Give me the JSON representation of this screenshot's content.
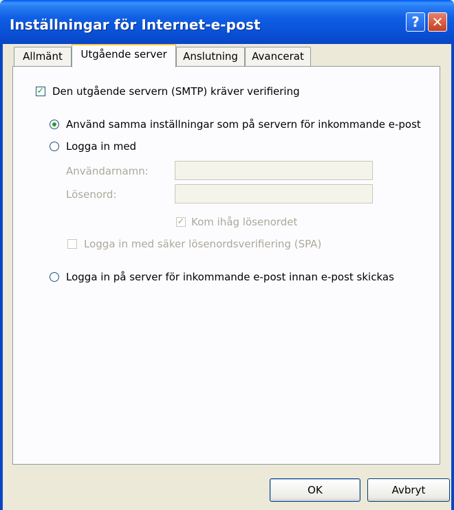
{
  "window": {
    "title": "Inställningar för Internet-e-post",
    "help_glyph": "?",
    "close_glyph": "✕"
  },
  "tabs": [
    {
      "label": "Allmänt",
      "selected": false
    },
    {
      "label": "Utgående server",
      "selected": true
    },
    {
      "label": "Anslutning",
      "selected": false
    },
    {
      "label": "Avancerat",
      "selected": false
    }
  ],
  "outgoing": {
    "smtp_auth": {
      "label": "Den utgående servern (SMTP) kräver verifiering",
      "checked": true
    },
    "radio_same": {
      "label": "Använd samma inställningar som på servern för inkommande e-post",
      "selected": true
    },
    "radio_login": {
      "label": "Logga in med",
      "selected": false
    },
    "username": {
      "label": "Användarnamn:",
      "value": ""
    },
    "password": {
      "label": "Lösenord:",
      "value": ""
    },
    "remember": {
      "label": "Kom ihåg lösenordet",
      "checked": true,
      "enabled": false
    },
    "spa": {
      "label": "Logga in med säker lösenordsverifiering (SPA)",
      "checked": false,
      "enabled": false
    },
    "radio_incoming": {
      "label": "Logga in på server för inkommande e-post innan e-post skickas",
      "selected": false
    }
  },
  "buttons": {
    "ok": "OK",
    "cancel": "Avbryt"
  },
  "checkmark": "✓"
}
